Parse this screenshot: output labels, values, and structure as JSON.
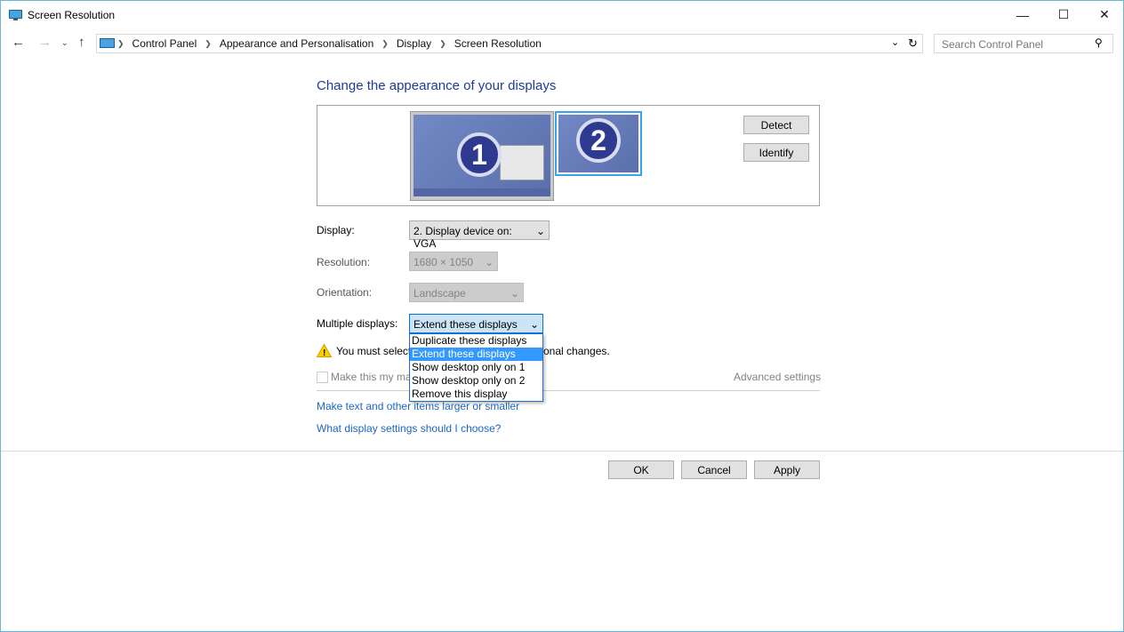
{
  "window": {
    "title": "Screen Resolution",
    "icon": "monitor-icon"
  },
  "address": {
    "crumbs": [
      "Control Panel",
      "Appearance and Personalisation",
      "Display",
      "Screen Resolution"
    ],
    "search_placeholder": "Search Control Panel"
  },
  "main": {
    "heading": "Change the appearance of your displays",
    "monitors": [
      "1",
      "2"
    ],
    "detect": "Detect",
    "identify": "Identify",
    "display_label": "Display:",
    "display_value": "2. Display device on: VGA",
    "resolution_label": "Resolution:",
    "resolution_value": "1680 × 1050",
    "orientation_label": "Orientation:",
    "orientation_value": "Landscape",
    "multiple_label": "Multiple displays:",
    "multiple_value": "Extend these displays",
    "options": [
      "Duplicate these displays",
      "Extend these displays",
      "Show desktop only on 1",
      "Show desktop only on 2",
      "Remove this display"
    ],
    "warning_left": "You must select",
    "warning_right": "onal changes.",
    "main_checkbox": "Make this my ma",
    "advanced": "Advanced settings",
    "link1": "Make text and other items larger or smaller",
    "link2": "What display settings should I choose?"
  },
  "footer": {
    "ok": "OK",
    "cancel": "Cancel",
    "apply": "Apply"
  }
}
